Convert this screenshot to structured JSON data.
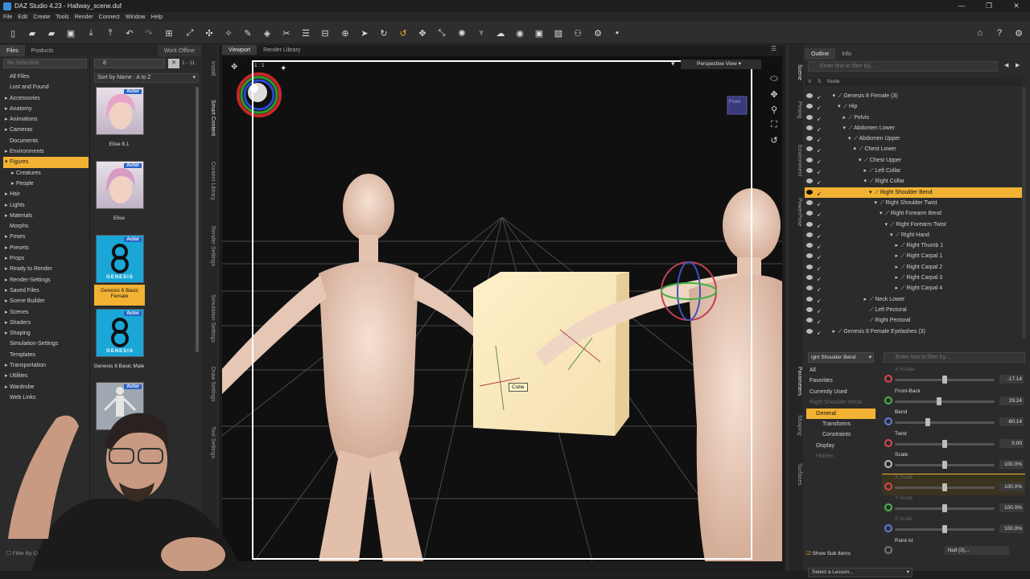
{
  "window": {
    "title": "DAZ Studio 4.23 - Hallway_scene.duf",
    "controls": [
      "—",
      "❐",
      "✕"
    ]
  },
  "menu": [
    "File",
    "Edit",
    "Create",
    "Tools",
    "Render",
    "Connect",
    "Window",
    "Help"
  ],
  "left": {
    "tabs": [
      "Files",
      "Products",
      "Work Offline"
    ],
    "filter_placeholder": "No Selection",
    "categories": [
      {
        "label": "All Files",
        "indent": 0,
        "arrow": ""
      },
      {
        "label": "Lost and Found",
        "indent": 0,
        "arrow": ""
      },
      {
        "label": "Accessories",
        "indent": 0,
        "arrow": "▸"
      },
      {
        "label": "Anatomy",
        "indent": 0,
        "arrow": "▸"
      },
      {
        "label": "Animations",
        "indent": 0,
        "arrow": "▸"
      },
      {
        "label": "Cameras",
        "indent": 0,
        "arrow": "▸"
      },
      {
        "label": "Documents",
        "indent": 0,
        "arrow": ""
      },
      {
        "label": "Environments",
        "indent": 0,
        "arrow": "▸"
      },
      {
        "label": "Figures",
        "indent": 0,
        "arrow": "▾",
        "selected": true
      },
      {
        "label": "Creatures",
        "indent": 1,
        "arrow": "▸"
      },
      {
        "label": "People",
        "indent": 1,
        "arrow": "▸"
      },
      {
        "label": "Hair",
        "indent": 0,
        "arrow": "▸"
      },
      {
        "label": "Lights",
        "indent": 0,
        "arrow": "▸"
      },
      {
        "label": "Materials",
        "indent": 0,
        "arrow": "▸"
      },
      {
        "label": "Morphs",
        "indent": 0,
        "arrow": ""
      },
      {
        "label": "Poses",
        "indent": 0,
        "arrow": "▸"
      },
      {
        "label": "Presets",
        "indent": 0,
        "arrow": "▸"
      },
      {
        "label": "Props",
        "indent": 0,
        "arrow": "▸"
      },
      {
        "label": "Ready to Render",
        "indent": 0,
        "arrow": "▸"
      },
      {
        "label": "Render-Settings",
        "indent": 0,
        "arrow": "▸"
      },
      {
        "label": "Saved Files",
        "indent": 0,
        "arrow": "▸"
      },
      {
        "label": "Scene Builder",
        "indent": 0,
        "arrow": "▸"
      },
      {
        "label": "Scenes",
        "indent": 0,
        "arrow": "▸"
      },
      {
        "label": "Shaders",
        "indent": 0,
        "arrow": "▸"
      },
      {
        "label": "Shaping",
        "indent": 0,
        "arrow": "▸"
      },
      {
        "label": "Simulation-Settings",
        "indent": 0,
        "arrow": ""
      },
      {
        "label": "Templates",
        "indent": 0,
        "arrow": ""
      },
      {
        "label": "Transportation",
        "indent": 0,
        "arrow": "▸"
      },
      {
        "label": "Utilities",
        "indent": 0,
        "arrow": "▸"
      },
      {
        "label": "Wardrobe",
        "indent": 0,
        "arrow": "▸"
      },
      {
        "label": "Web Links",
        "indent": 0,
        "arrow": ""
      }
    ],
    "filter_by_context": "Filter By Context",
    "search_value": "8",
    "result_count": "1 - 11",
    "sort": "Sort by Name : A to Z",
    "thumbs": [
      {
        "label": "Elise 8.1",
        "badge": "Actor",
        "kind": "face",
        "hair": "#e7a3c8",
        "selected": false
      },
      {
        "label": "Elise",
        "badge": "Actor",
        "kind": "face",
        "hair": "#d79cc3",
        "selected": false
      },
      {
        "label": "Genesis 8 Basic Female",
        "badge": "Actor",
        "kind": "genesis",
        "selected": true
      },
      {
        "label": "Genesis 8 Basic Male",
        "badge": "Actor",
        "kind": "genesis",
        "selected": false
      },
      {
        "label": "",
        "badge": "Actor",
        "kind": "body",
        "selected": false
      }
    ],
    "genesis_text": "GENESIS"
  },
  "vtabs_left": [
    "Install",
    "Smart Content",
    "Content Library",
    "Render Settings",
    "Simulation Settings",
    "Draw Settings",
    "Tool Settings"
  ],
  "viewport": {
    "tabs": [
      "Viewport",
      "Render Library"
    ],
    "camera": "Perspective View",
    "aspect": "1 : 1",
    "tooltip": "Cube",
    "nav_label": "Front"
  },
  "outline": {
    "tabs": [
      "Outline",
      "Info"
    ],
    "filter_placeholder": "Enter text to filter by...",
    "header": {
      "s1": "V",
      "s2": "S",
      "node": "Node"
    },
    "rows": [
      {
        "label": "Genesis 8 Female (3)",
        "indent": 1,
        "arrow": "▾"
      },
      {
        "label": "Hip",
        "indent": 2,
        "arrow": "▾"
      },
      {
        "label": "Pelvis",
        "indent": 3,
        "arrow": "▸"
      },
      {
        "label": "Abdomen Lower",
        "indent": 3,
        "arrow": "▾"
      },
      {
        "label": "Abdomen Upper",
        "indent": 4,
        "arrow": "▾"
      },
      {
        "label": "Chest Lower",
        "indent": 5,
        "arrow": "▾"
      },
      {
        "label": "Chest Upper",
        "indent": 6,
        "arrow": "▾"
      },
      {
        "label": "Left Collar",
        "indent": 7,
        "arrow": "▸"
      },
      {
        "label": "Right Collar",
        "indent": 7,
        "arrow": "▾"
      },
      {
        "label": "Right Shoulder Bend",
        "indent": 8,
        "arrow": "▾",
        "selected": true
      },
      {
        "label": "Right Shoulder Twist",
        "indent": 9,
        "arrow": "▾"
      },
      {
        "label": "Right Forearm Bend",
        "indent": 10,
        "arrow": "▾"
      },
      {
        "label": "Right Forearm Twist",
        "indent": 11,
        "arrow": "▾"
      },
      {
        "label": "Right Hand",
        "indent": 12,
        "arrow": "▾"
      },
      {
        "label": "Right Thumb 1",
        "indent": 13,
        "arrow": "▸"
      },
      {
        "label": "Right Carpal 1",
        "indent": 13,
        "arrow": "▸"
      },
      {
        "label": "Right Carpal 2",
        "indent": 13,
        "arrow": "▸"
      },
      {
        "label": "Right Carpal 3",
        "indent": 13,
        "arrow": "▸"
      },
      {
        "label": "Right Carpal 4",
        "indent": 13,
        "arrow": "▸"
      },
      {
        "label": "Neck Lower",
        "indent": 7,
        "arrow": "▸"
      },
      {
        "label": "Left Pectoral",
        "indent": 7,
        "arrow": ""
      },
      {
        "label": "Right Pectoral",
        "indent": 7,
        "arrow": ""
      },
      {
        "label": "Genesis 8 Female Eyelashes (3)",
        "indent": 1,
        "arrow": "▸"
      }
    ]
  },
  "vtabs_right": [
    "Scene",
    "Posing",
    "Environment",
    "PowerPose",
    "Parameters",
    "Shaping",
    "Surfaces"
  ],
  "params": {
    "node": "ight Shoulder Bend",
    "filter_placeholder": "Enter text to filter by...",
    "tree": [
      {
        "label": "All",
        "indent": 0,
        "dim": false
      },
      {
        "label": "Favorites",
        "indent": 0,
        "dim": false
      },
      {
        "label": "Currently Used",
        "indent": 0,
        "dim": false
      },
      {
        "label": "Right Shoulder Bend",
        "indent": 0,
        "dim": true
      },
      {
        "label": "General",
        "indent": 1,
        "selected": true
      },
      {
        "label": "Transforms",
        "indent": 2,
        "dim": false
      },
      {
        "label": "Constraints",
        "indent": 2,
        "dim": false
      },
      {
        "label": "Display",
        "indent": 1,
        "dim": false
      },
      {
        "label": "Hidden",
        "indent": 1,
        "dim": true
      }
    ],
    "sliders": [
      {
        "name": "X Rotate",
        "value": "-17.14",
        "pos": 0.5,
        "dim": true,
        "icon_color": "#d94a4a"
      },
      {
        "name": "Front-Back",
        "value": "29.24",
        "pos": 0.44,
        "dim": false,
        "icon_color": "#4ab54a"
      },
      {
        "name": "Bend",
        "value": "-60.14",
        "pos": 0.33,
        "dim": false,
        "icon_color": "#5f7ee0"
      },
      {
        "name": "Twist",
        "value": "0.00",
        "pos": 0.5,
        "dim": false,
        "icon_color": "#d94a4a"
      },
      {
        "name": "Scale",
        "value": "100.0%",
        "pos": 0.5,
        "dim": false,
        "icon_color": "#bbbbbb"
      },
      {
        "name": "X Scale",
        "value": "100.0%",
        "pos": 0.5,
        "dim": true,
        "icon_color": "#d94a4a",
        "highlight": true
      },
      {
        "name": "Y Scale",
        "value": "100.0%",
        "pos": 0.5,
        "dim": true,
        "icon_color": "#4ab54a"
      },
      {
        "name": "Z Scale",
        "value": "100.0%",
        "pos": 0.5,
        "dim": true,
        "icon_color": "#5f7ee0"
      },
      {
        "name": "Point At",
        "value": "Null (3)...",
        "pos": 0,
        "dim": false,
        "icon_color": "#777777",
        "nolock": true
      }
    ],
    "show_sub_items": "Show Sub Items"
  },
  "status": {
    "lesson": "Select a Lesson..."
  },
  "colors": {
    "accent": "#f2b233",
    "panel": "#2b2b2b",
    "dark": "#1d1d1d"
  }
}
